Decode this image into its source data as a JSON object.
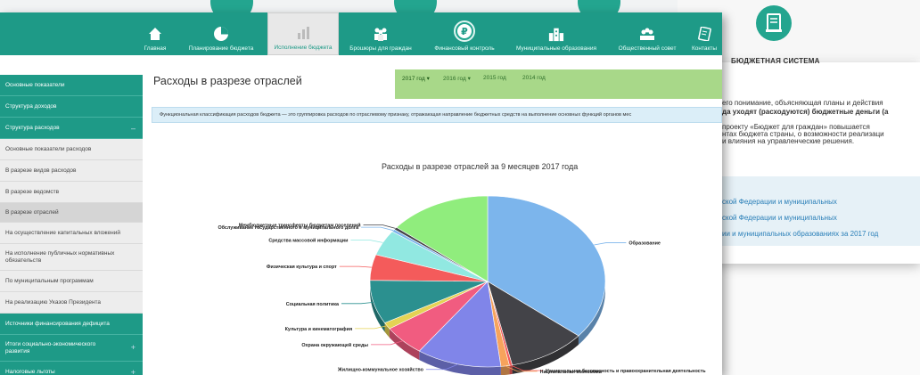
{
  "nav": {
    "items": [
      {
        "label": "Главная",
        "icon": "home-icon"
      },
      {
        "label": "Планирование бюджета",
        "icon": "pie-icon"
      },
      {
        "label": "Исполнение бюджета",
        "icon": "bar-chart-icon"
      },
      {
        "label": "Брошюры для граждан",
        "icon": "people-icon"
      },
      {
        "label": "Финансовый контроль",
        "icon": "ruble-icon"
      },
      {
        "label": "Муниципальные образования",
        "icon": "buildings-icon"
      },
      {
        "label": "Общественный совет",
        "icon": "council-icon"
      },
      {
        "label": "Контакты",
        "icon": "contacts-icon"
      }
    ]
  },
  "sidebar": {
    "items": [
      {
        "label": "Основные показатели"
      },
      {
        "label": "Структура доходов"
      },
      {
        "label": "Структура расходов",
        "toggle": "–"
      },
      {
        "label": "Основные показатели расходов"
      },
      {
        "label": "В разрезе видов расходов"
      },
      {
        "label": "В разрезе ведомств"
      },
      {
        "label": "В разрезе отраслей"
      },
      {
        "label": "На осуществление капитальных вложений"
      },
      {
        "label": "На исполнение публичных нормативных обязательств"
      },
      {
        "label": "По муниципальным программам"
      },
      {
        "label": "На реализацию Указов Президента"
      },
      {
        "label": "Источники финансирования дефицита"
      },
      {
        "label": "Итоги социально-экономического развития",
        "toggle": "+"
      },
      {
        "label": "Налоговые льготы",
        "toggle": "+"
      }
    ]
  },
  "page": {
    "title": "Расходы в разрезе отраслей",
    "years": [
      "2017 год",
      "2016 год",
      "2015 год",
      "2014 год"
    ],
    "year_arrow": "▾",
    "info_text": "Функциональная классификация расходов бюджета — это группировка расходов по отраслевому признаку, отражающая направление бюджетных средств на выполнение основных функций органов мес"
  },
  "chart_data": {
    "type": "pie",
    "title": "Расходы в разрезе отраслей за 9 месяцев 2017 года",
    "slices": [
      {
        "label": "Образование",
        "value": 37.0,
        "color": "#7cb5ec"
      },
      {
        "label": "",
        "value": 11.0,
        "color": "#434348"
      },
      {
        "label": "Национальная безопасность и правоохранительная деятельность",
        "value": 0.4,
        "color": "#f45b5b"
      },
      {
        "label": "Национальная экономика",
        "value": 1.2,
        "color": "#f7a35c"
      },
      {
        "label": "Жилищно-коммунальное хозяйство",
        "value": 12.0,
        "color": "#8085e9"
      },
      {
        "label": "Охрана окружающей среды",
        "value": 6.0,
        "color": "#f15c80"
      },
      {
        "label": "Культура и кинематография",
        "value": 1.3,
        "color": "#e4d354"
      },
      {
        "label": "Социальная политика",
        "value": 8.5,
        "color": "#2b908f"
      },
      {
        "label": "Физическая культура и спорт",
        "value": 5.0,
        "color": "#f45b5b"
      },
      {
        "label": "Средства массовой информации",
        "value": 5.0,
        "color": "#91e8e1"
      },
      {
        "label": "Обслуживание государственного и муниципального долга",
        "value": 0.5,
        "color": "#7cb5ec"
      },
      {
        "label": "Межбюджетные трансферты бюджетам поселений",
        "value": 0.5,
        "color": "#434348"
      },
      {
        "label": "",
        "value": 14.5,
        "color": "#90ed7d"
      }
    ]
  },
  "background": {
    "title": "БЮДЖЕТНАЯ СИСТЕМА",
    "lines": [
      "его понимание, объясняющая планы и действия",
      "да уходят (расходуются) бюджетные деньги (а",
      "проекту «Бюджет для граждан» повышается",
      "нтах бюджета страны, о возможности реализаци",
      "и влияния на управленческие решения."
    ],
    "links": [
      "ской Федерации и муниципальных",
      "ской Федерации и муниципальных",
      "ии и муниципальных образованиях за 2017 год"
    ]
  }
}
